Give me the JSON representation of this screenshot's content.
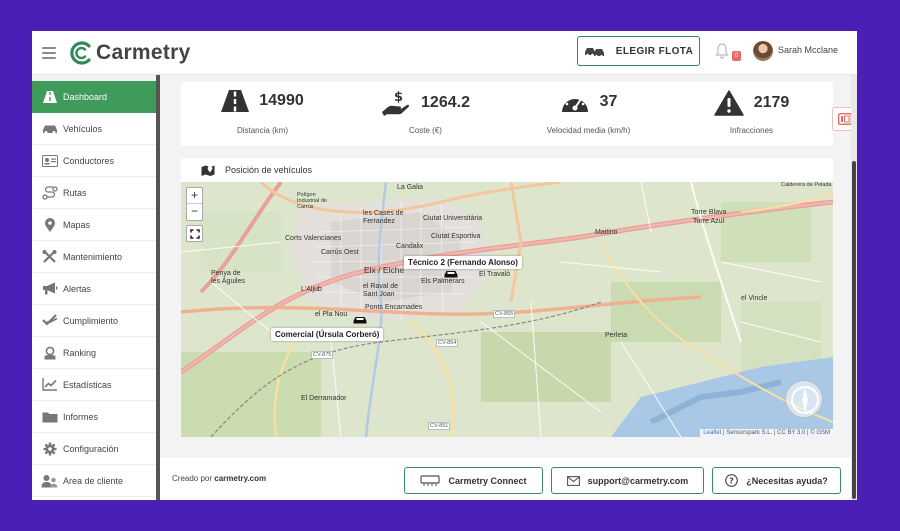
{
  "header": {
    "logo_text": "Carmetry",
    "fleet_button": "ELEGIR FLOTA",
    "notification_count": "0",
    "user_name": "Sarah Mcclane"
  },
  "sidebar": {
    "items": [
      {
        "label": "Dashboard",
        "icon": "road-icon",
        "active": true
      },
      {
        "label": "Vehículos",
        "icon": "car-icon"
      },
      {
        "label": "Conductores",
        "icon": "id-card-icon"
      },
      {
        "label": "Rutas",
        "icon": "route-icon"
      },
      {
        "label": "Mapas",
        "icon": "map-marker-icon"
      },
      {
        "label": "Mantenimiento",
        "icon": "tools-icon"
      },
      {
        "label": "Alertas",
        "icon": "megaphone-icon"
      },
      {
        "label": "Cumplimiento",
        "icon": "check-double-icon"
      },
      {
        "label": "Ranking",
        "icon": "user-rank-icon"
      },
      {
        "label": "Estadísticas",
        "icon": "line-chart-icon"
      },
      {
        "label": "Informes",
        "icon": "folder-icon"
      },
      {
        "label": "Configuración",
        "icon": "gear-icon"
      },
      {
        "label": "Area de cliente",
        "icon": "users-icon"
      }
    ]
  },
  "stats": [
    {
      "value": "14990",
      "label": "Distancia (km)",
      "icon": "road-icon"
    },
    {
      "value": "1264.2",
      "label": "Coste (€)",
      "icon": "money-hand-icon"
    },
    {
      "value": "37",
      "label": "Velocidad media (km/h)",
      "icon": "speedometer-icon"
    },
    {
      "value": "2179",
      "label": "Infracciones",
      "icon": "warning-icon"
    }
  ],
  "map": {
    "title": "Posición de vehículos",
    "zoom_in": "+",
    "zoom_out": "−",
    "vehicles": [
      {
        "label": "Técnico 2 (Fernando Alonso)"
      },
      {
        "label": "Comercial (Úrsula Corberó)"
      }
    ],
    "places": [
      "La Galia",
      "Polígon Industrial de Carrús",
      "les Cases de Ferrandez",
      "Ciutat Universitària",
      "Ciutat Esportiva",
      "Corts Valencianes",
      "Carrús Oest",
      "Candalix",
      "Penya de les Àguiles",
      "Elx / Elche",
      "el Raval de Sant Joan",
      "Els Palmerars",
      "El Travalò",
      "L'Aljub",
      "Ponts Encarnades",
      "el Pla Nou",
      "Maitino",
      "Torre Blava",
      "Torre Azul",
      "el Vincle",
      "Perleta",
      "El Derramador",
      "Calderera de Pelada"
    ],
    "roads": [
      "CV-865",
      "CV-854",
      "CV-875",
      "CV-851"
    ],
    "attribution": {
      "leaflet": "Leaflet",
      "rest": " | Sensorspark S.L. | CC BY 3.0 | © GSM"
    }
  },
  "footer": {
    "created_by_prefix": "Creado por ",
    "created_by_site": "carmetry.com",
    "connect_button": "Carmetry Connect",
    "support_button": "support@carmetry.com",
    "help_button": "¿Necesitas ayuda?"
  },
  "colors": {
    "brand_green": "#3e9b5a",
    "background": "#4a1fb5"
  }
}
